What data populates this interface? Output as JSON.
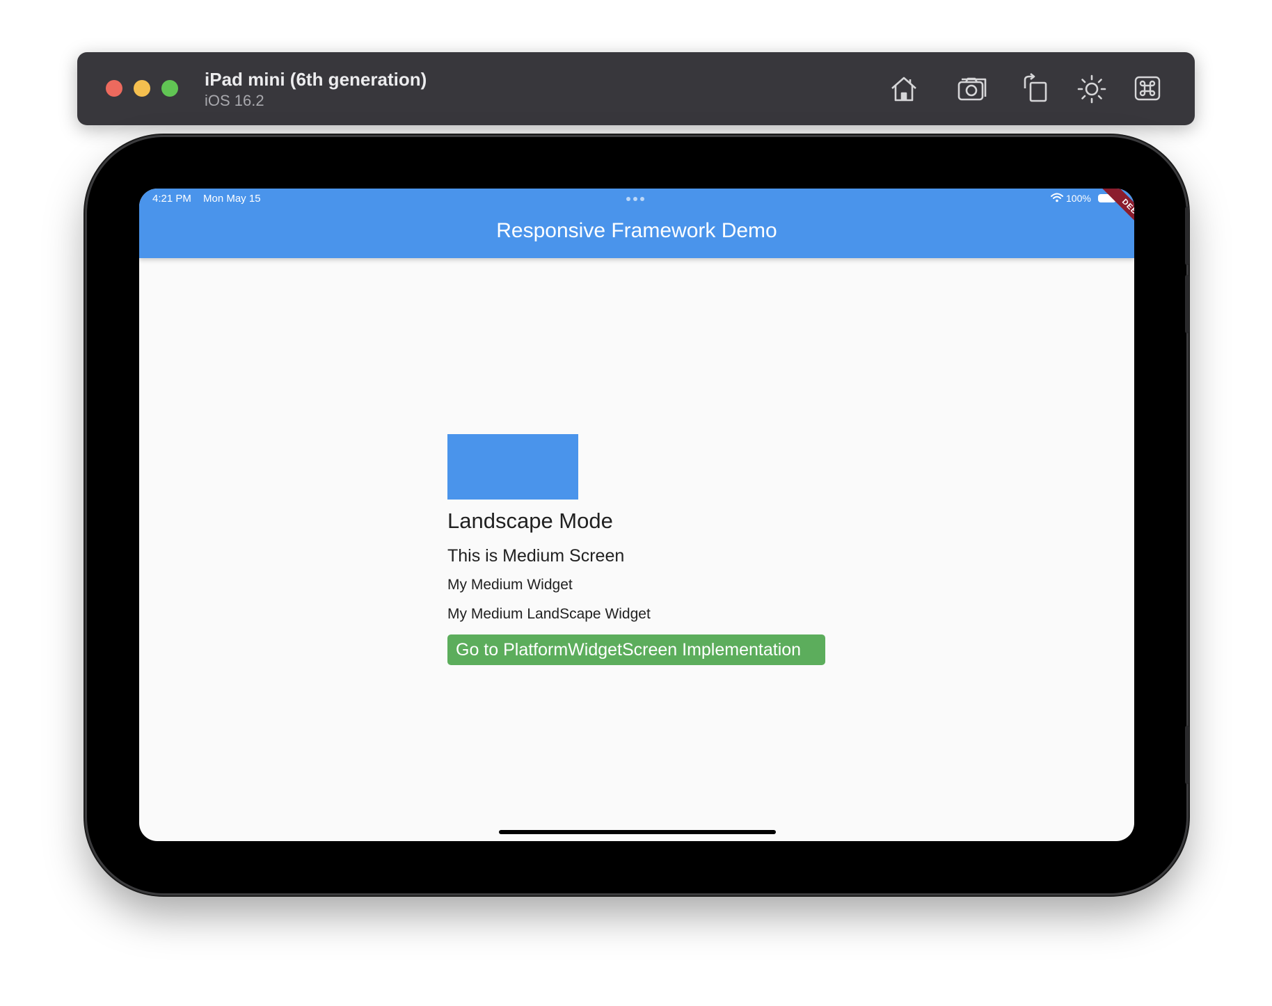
{
  "simulator": {
    "device_name": "iPad mini (6th generation)",
    "os_version": "iOS 16.2",
    "toolbar_icons": [
      "home-icon",
      "screenshot-icon",
      "rotate-icon",
      "appearance-icon",
      "command-icon"
    ]
  },
  "status_bar": {
    "time": "4:21 PM",
    "date": "Mon May 15",
    "battery": "100%"
  },
  "app_bar": {
    "title": "Responsive Framework Demo",
    "debug_banner": "DEBUG"
  },
  "content": {
    "heading": "Landscape Mode",
    "screen_size_text": "This is Medium Screen",
    "widget_text": "My Medium Widget",
    "landscape_widget_text": "My Medium LandScape Widget",
    "button_label": "Go to PlatformWidgetScreen Implementation"
  },
  "colors": {
    "app_bar": "#4a94eb",
    "button": "#5cad5c",
    "debug_banner": "#8b1d2d"
  }
}
